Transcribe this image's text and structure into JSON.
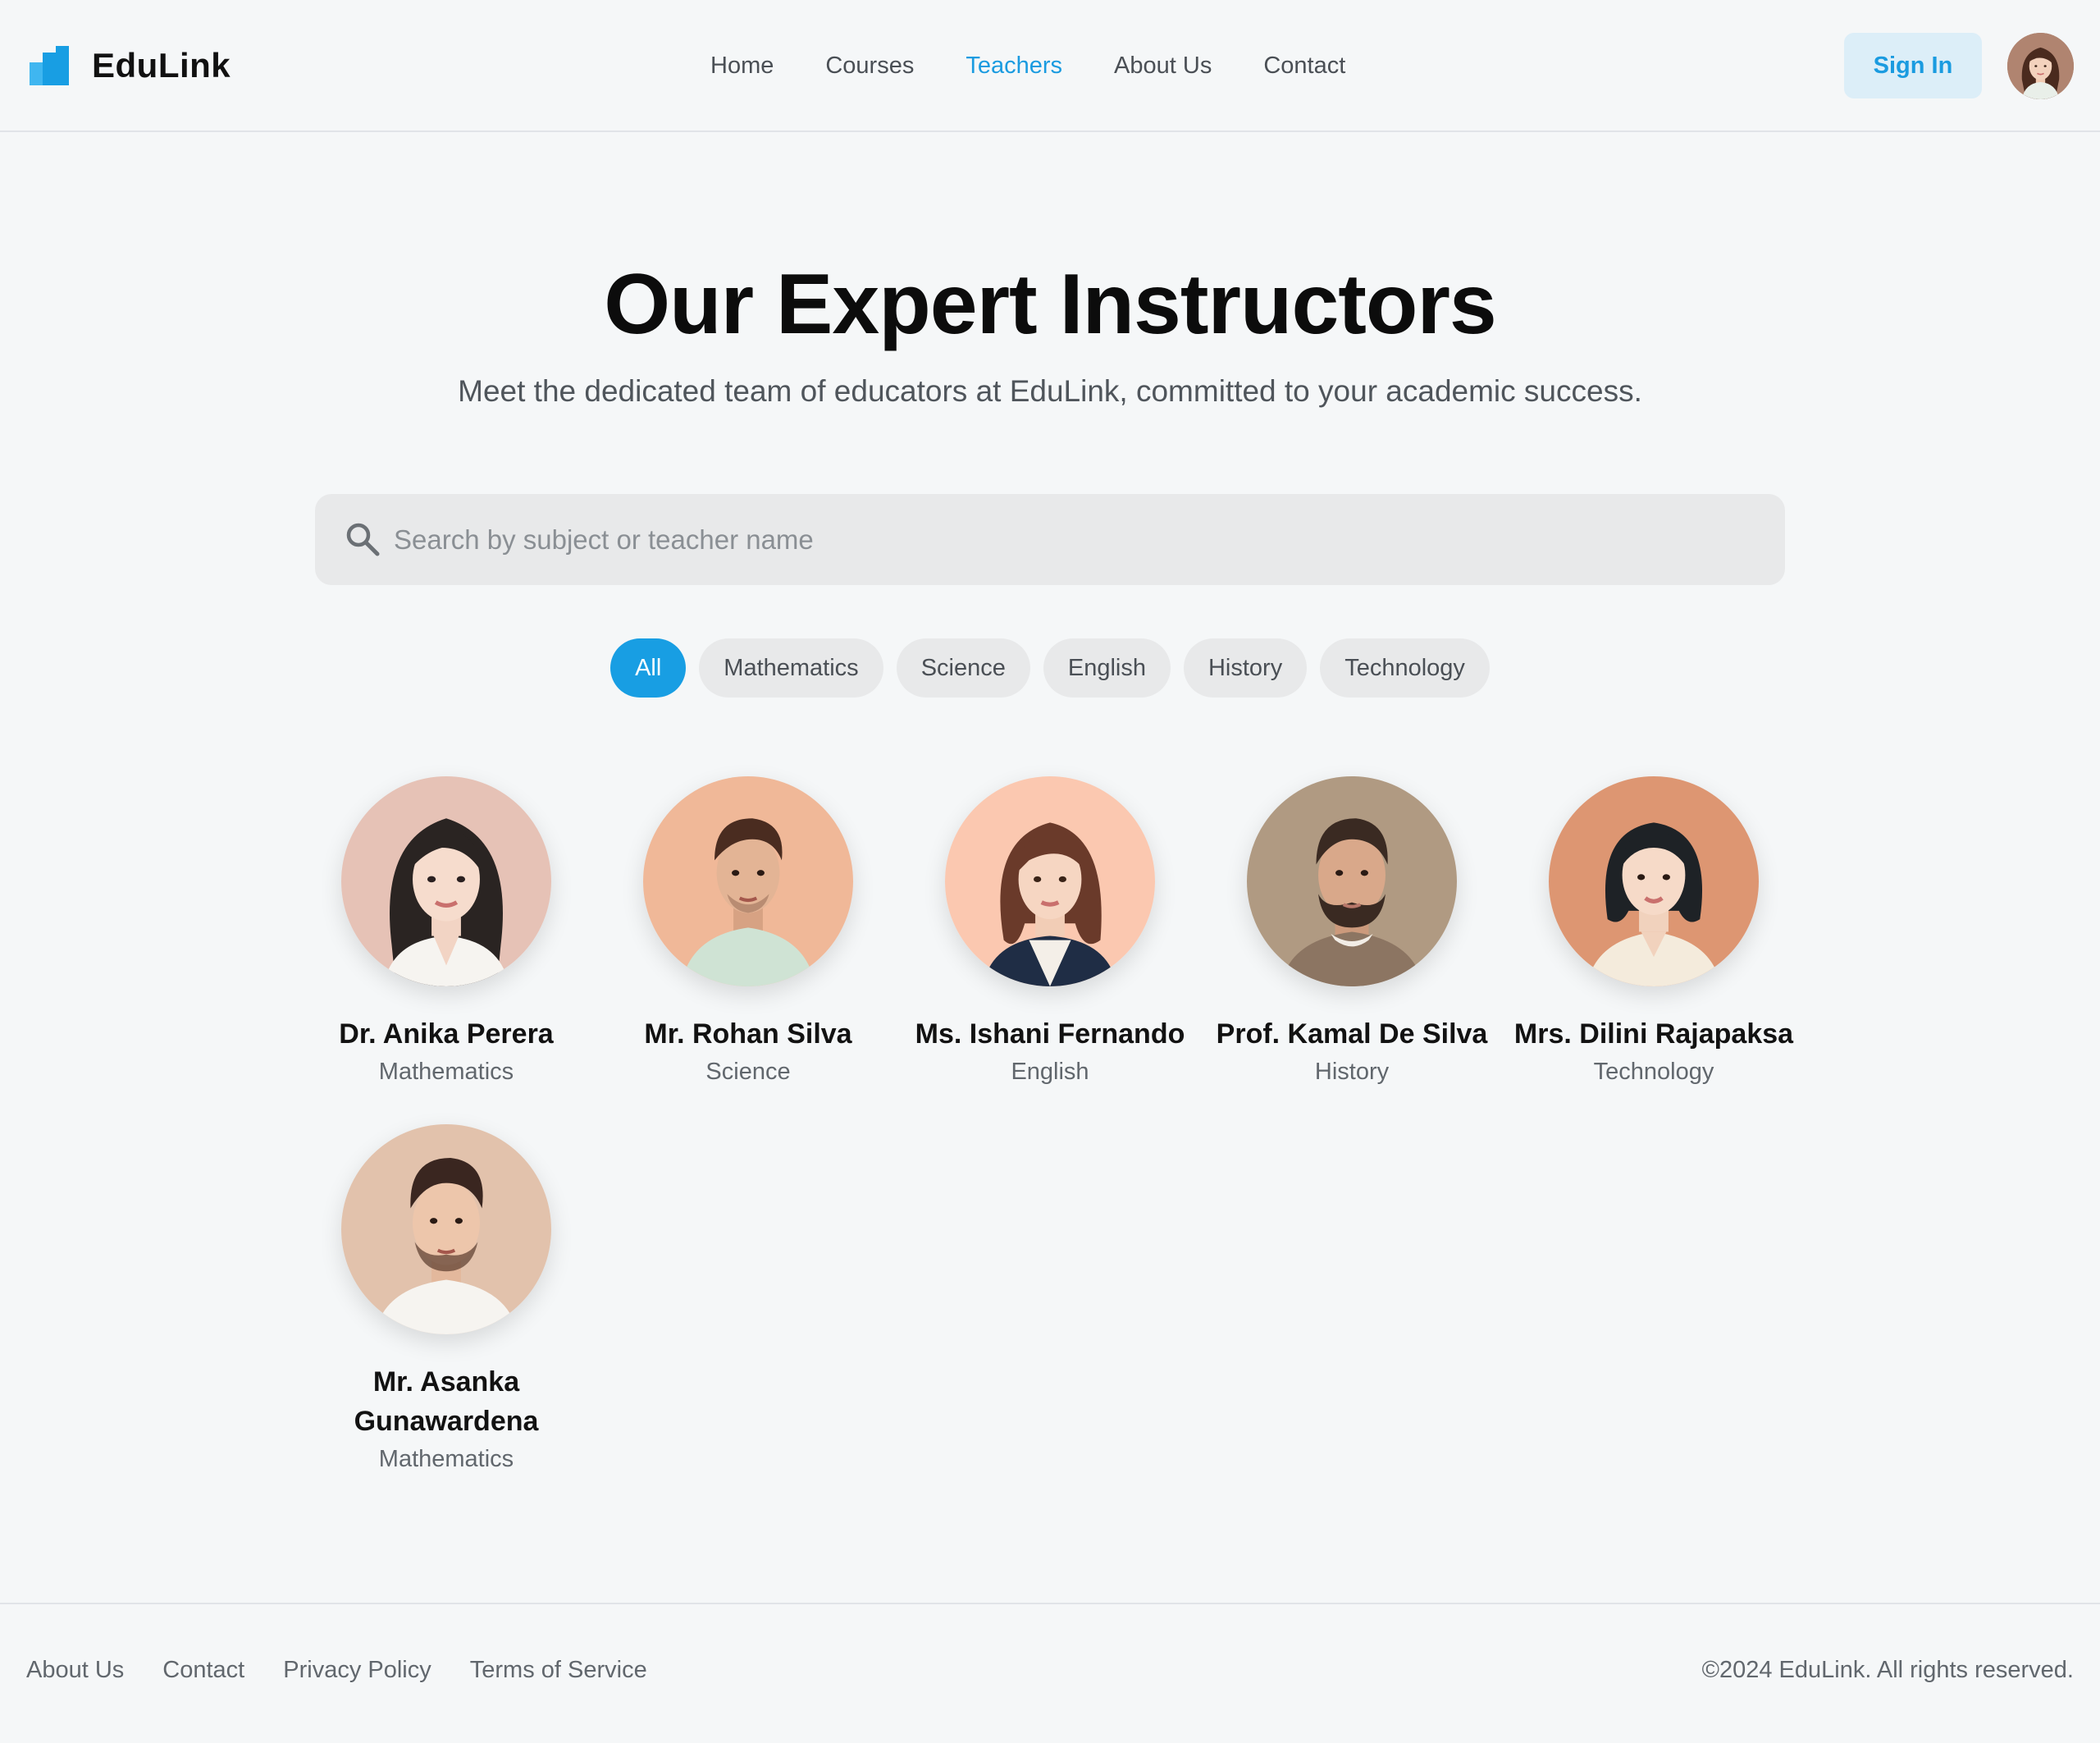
{
  "header": {
    "brand": "EduLink",
    "nav": [
      {
        "label": "Home",
        "active": false
      },
      {
        "label": "Courses",
        "active": false
      },
      {
        "label": "Teachers",
        "active": true
      },
      {
        "label": "About Us",
        "active": false
      },
      {
        "label": "Contact",
        "active": false
      }
    ],
    "sign_in": "Sign In",
    "accent_color": "#1a9be0"
  },
  "hero": {
    "title": "Our Expert Instructors",
    "subtitle": "Meet the dedicated team of educators at EduLink, committed to your academic success."
  },
  "search": {
    "placeholder": "Search by subject or teacher name",
    "value": "",
    "icon": "search-icon"
  },
  "filters": [
    {
      "label": "All",
      "active": true
    },
    {
      "label": "Mathematics",
      "active": false
    },
    {
      "label": "Science",
      "active": false
    },
    {
      "label": "English",
      "active": false
    },
    {
      "label": "History",
      "active": false
    },
    {
      "label": "Technology",
      "active": false
    }
  ],
  "teachers": [
    {
      "name": "Dr. Anika Perera",
      "subject": "Mathematics"
    },
    {
      "name": "Mr. Rohan Silva",
      "subject": "Science"
    },
    {
      "name": "Ms. Ishani Fernando",
      "subject": "English"
    },
    {
      "name": "Prof. Kamal De Silva",
      "subject": "History"
    },
    {
      "name": "Mrs. Dilini Rajapaksa",
      "subject": "Technology"
    },
    {
      "name": "Mr. Asanka Gunawardena",
      "subject": "Mathematics"
    }
  ],
  "footer": {
    "links": [
      "About Us",
      "Contact",
      "Privacy Policy",
      "Terms of Service"
    ],
    "copyright": "©2024 EduLink. All rights reserved."
  }
}
